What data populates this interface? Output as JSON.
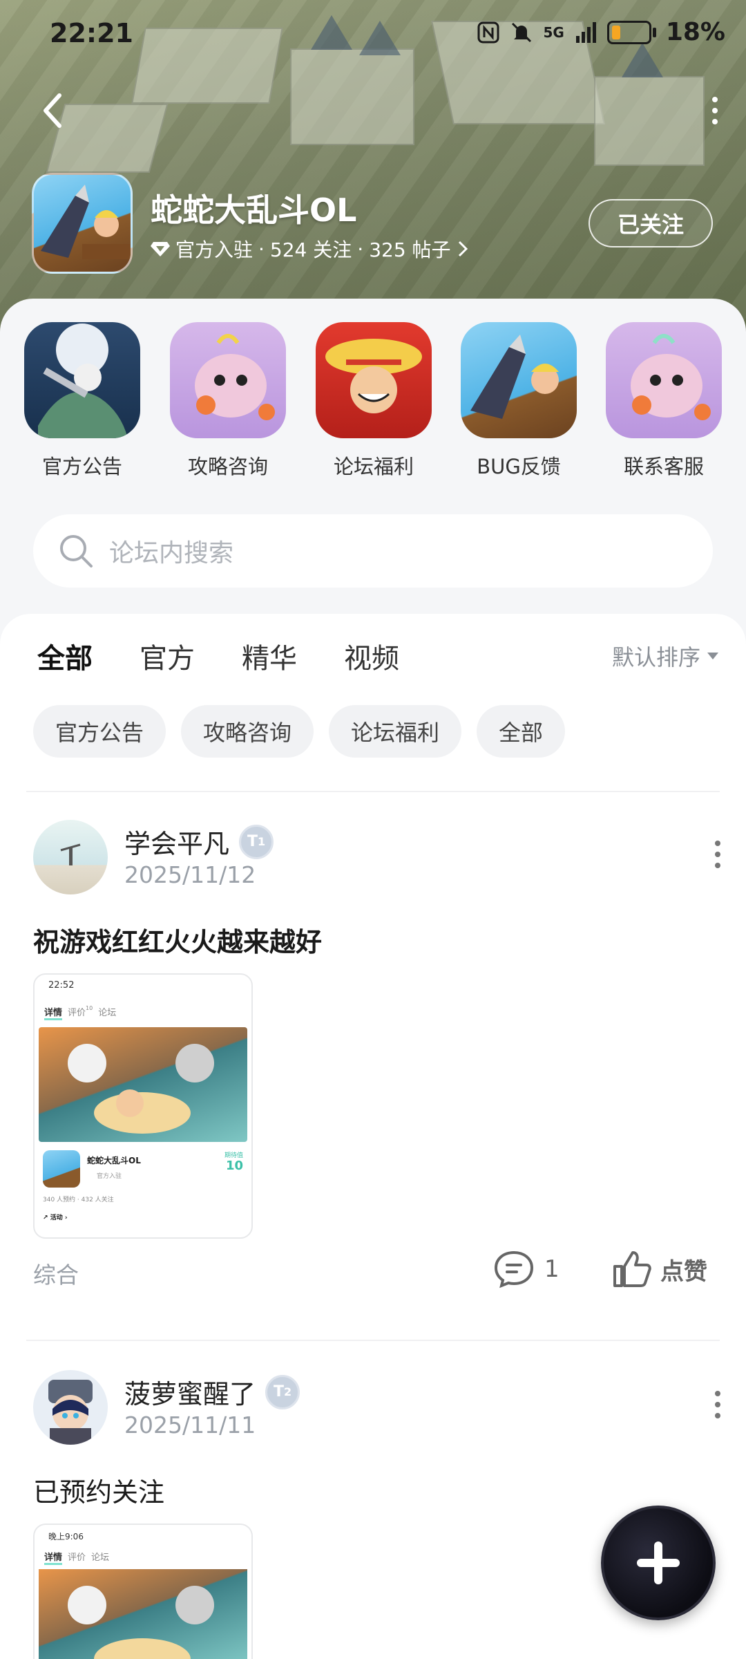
{
  "status_bar": {
    "time": "22:21",
    "battery": "18%",
    "network": "5G"
  },
  "header": {
    "game_title": "蛇蛇大乱斗OL",
    "official": "官方入驻",
    "follows": "524 关注",
    "posts": "325 帖子",
    "follow_button": "已关注",
    "sep": "·"
  },
  "shortcuts": [
    {
      "label": "官方公告"
    },
    {
      "label": "攻略咨询"
    },
    {
      "label": "论坛福利"
    },
    {
      "label": "BUG反馈"
    },
    {
      "label": "联系客服"
    }
  ],
  "search": {
    "placeholder": "论坛内搜索"
  },
  "tabs": [
    {
      "label": "全部",
      "active": true
    },
    {
      "label": "官方"
    },
    {
      "label": "精华"
    },
    {
      "label": "视频"
    }
  ],
  "sort": {
    "label": "默认排序"
  },
  "chips": [
    "官方公告",
    "攻略咨询",
    "论坛福利",
    "全部"
  ],
  "posts": [
    {
      "user": "学会平凡",
      "level": "1",
      "date": "2025/11/12",
      "title": "祝游戏红红火火越来越好",
      "category": "综合",
      "comments": "1",
      "like_label": "点赞",
      "thumb": {
        "time": "22:52",
        "tab_detail": "详情",
        "tab_review": "评价",
        "review_count": "10",
        "tab_forum": "论坛",
        "game_name": "蛇蛇大乱斗OL",
        "official": "官方入驻",
        "score_label": "期待值",
        "score": "10",
        "stats": "340 人预约 · 432 人关注",
        "activity": "活动"
      }
    },
    {
      "user": "菠萝蜜醒了",
      "level": "2",
      "date": "2025/11/11",
      "title": "已预约关注",
      "thumb": {
        "time": "晚上9:06",
        "tab_detail": "详情",
        "tab_review": "评价",
        "tab_forum": "论坛"
      }
    }
  ],
  "colors": {
    "accent": "#7ee1cf",
    "banner": "#8c9475",
    "fab": "#0d0d14"
  }
}
